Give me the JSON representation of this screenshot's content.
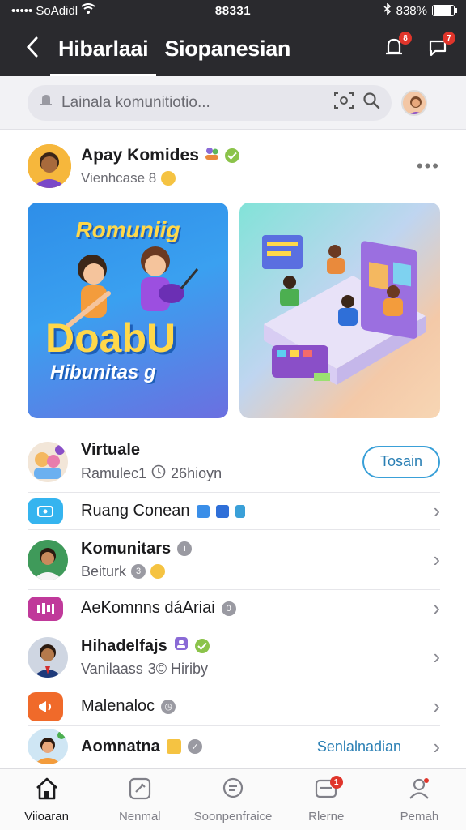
{
  "status_bar": {
    "carrier": "••••• SoAdidl",
    "time": "88331",
    "battery": "838%"
  },
  "header": {
    "tabs": [
      {
        "label": "Hibarlaai",
        "active": true
      },
      {
        "label": "Siopanesian",
        "active": false
      }
    ],
    "notification_badge": "8",
    "message_badge": "7"
  },
  "search": {
    "placeholder": "Lainala komunitiotio..."
  },
  "post": {
    "author": "Apay Komides",
    "subtitle": "Vienhcase 8",
    "media_left": {
      "title": "Romuniig",
      "big_text": "DoabU",
      "sub_text": "Hibunitas g"
    }
  },
  "list": {
    "items": [
      {
        "title": "Virtuale",
        "subtitle": "Ramulec1",
        "subtitle_extra": "26hioyn",
        "action": "Tosain"
      },
      {
        "title": "Ruang Conean"
      },
      {
        "title": "Komunitars",
        "subtitle": "Beiturk"
      },
      {
        "title": "AeKomnns dáAriai"
      },
      {
        "title": "Hihadelfajs",
        "subtitle": "Vanilaass",
        "subtitle_extra": "3© Hiriby"
      },
      {
        "title": "Malenaloc"
      },
      {
        "title": "Aomnatna",
        "link": "Senlalnadian"
      }
    ]
  },
  "bottom_nav": {
    "items": [
      {
        "label": "Viioaran",
        "active": true
      },
      {
        "label": "Nenmal",
        "active": false
      },
      {
        "label": "Soonpenfraice",
        "active": false
      },
      {
        "label": "Rlerne",
        "active": false,
        "badge": "1"
      },
      {
        "label": "Pemah",
        "active": false
      }
    ]
  },
  "colors": {
    "header_bg": "#2a2a2e",
    "accent_blue": "#2a7fb4",
    "badge_red": "#e0352b",
    "verified_green": "#8bc34a"
  }
}
